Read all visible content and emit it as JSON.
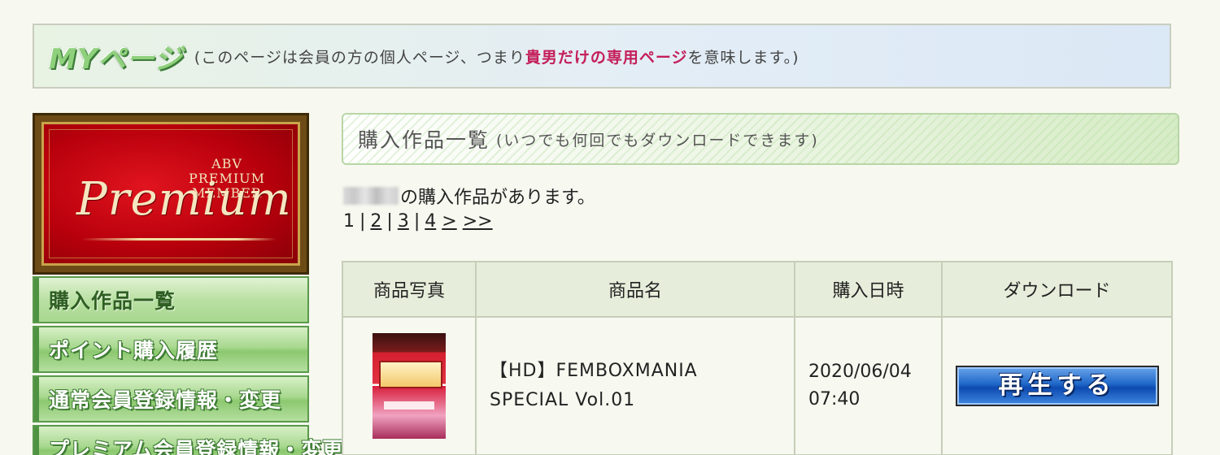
{
  "banner": {
    "title": "MYページ",
    "desc_before": "(このページは会員の方の個人ページ、つまり",
    "desc_highlight": "貴男だけの専用ページ",
    "desc_after": "を意味します。)"
  },
  "premium": {
    "line1": "ABV",
    "line2": "PREMIUM",
    "line3": "MEMBER",
    "script": "Premium"
  },
  "sidebar": {
    "items": [
      {
        "label": "購入作品一覧"
      },
      {
        "label": "ポイント購入履歴"
      },
      {
        "label": "通常会員登録情報・変更"
      },
      {
        "label": "プレミアム会員登録情報・変更"
      }
    ]
  },
  "section": {
    "title": "購入作品一覧",
    "subtitle": "(いつでも何回でもダウンロードできます)"
  },
  "purchase_notice": "の購入作品があります。",
  "pager": {
    "current": "1",
    "pages": [
      "2",
      "3",
      "4"
    ],
    "next": ">",
    "last": ">>"
  },
  "table": {
    "headers": {
      "photo": "商品写真",
      "name": "商品名",
      "date": "購入日時",
      "download": "ダウンロード"
    },
    "rows": [
      {
        "name_line1": "【HD】FEMBOXMANIA",
        "name_line2": "SPECIAL Vol.01",
        "date_line1": "2020/06/04",
        "date_line2": "07:40",
        "play_label": "再生する"
      }
    ]
  },
  "colors": {
    "accent_green": "#8cc86f",
    "highlight_pink": "#c41e5a",
    "play_blue": "#1f67c8",
    "premium_red": "#c8000f"
  }
}
